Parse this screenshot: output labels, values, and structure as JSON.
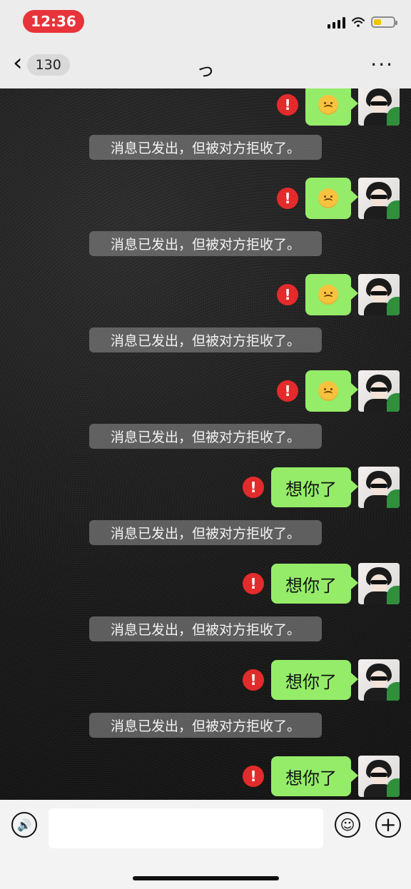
{
  "status_bar": {
    "time": "12:36"
  },
  "header": {
    "back_count": "130",
    "title": "っ",
    "more": "···"
  },
  "messages": [
    {
      "type": "emoji",
      "content": "😞",
      "status": "!",
      "notice": "消息已发出，但被对方拒收了。"
    },
    {
      "type": "emoji",
      "content": "😞",
      "status": "!",
      "notice": "消息已发出，但被对方拒收了。"
    },
    {
      "type": "emoji",
      "content": "😞",
      "status": "!",
      "notice": "消息已发出，但被对方拒收了。"
    },
    {
      "type": "emoji",
      "content": "😞",
      "status": "!",
      "notice": "消息已发出，但被对方拒收了。"
    },
    {
      "type": "text",
      "content": "想你了",
      "status": "!",
      "notice": "消息已发出，但被对方拒收了。"
    },
    {
      "type": "text",
      "content": "想你了",
      "status": "!",
      "notice": "消息已发出，但被对方拒收了。"
    },
    {
      "type": "text",
      "content": "想你了",
      "status": "!",
      "notice": "消息已发出，但被对方拒收了。"
    },
    {
      "type": "text",
      "content": "想你了",
      "status": "!"
    }
  ],
  "input_bar": {
    "placeholder": "",
    "value": ""
  },
  "colors": {
    "time_pill": "#e8333b",
    "bubble": "#95ec69",
    "warning": "#e32b2b",
    "system_notice": "#787878"
  }
}
